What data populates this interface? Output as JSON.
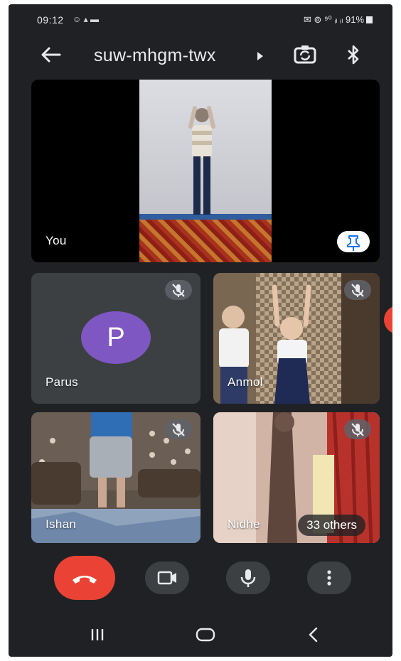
{
  "status_bar": {
    "time": "09:12",
    "left_icons": "☺ ▴ ▬",
    "right_text": "✉ ⊚ ⁹⁰ ᵢₗ ᵢₗ 91%",
    "battery_percent": "91%"
  },
  "app_bar": {
    "meeting_code": "suw-mhgm-twx",
    "icons": [
      "back-arrow-icon",
      "caret-right-icon",
      "switch-camera-icon",
      "bluetooth-icon"
    ]
  },
  "tiles": {
    "you": {
      "label": "You"
    },
    "parus": {
      "label": "Parus",
      "avatar_letter": "P",
      "avatar_color": "#7e57c2"
    },
    "anmol": {
      "label": "Anmol"
    },
    "ishan": {
      "label": "Ishan"
    },
    "nidhi": {
      "label": "Nidhe"
    },
    "others_chip": "33 others"
  },
  "controls": {
    "hangup_color": "#ea4335",
    "icons": [
      "call-end-icon",
      "camera-icon",
      "mic-icon",
      "more-vert-icon"
    ]
  },
  "nav_bar": {
    "icons": [
      "recents-icon",
      "home-icon",
      "back-icon"
    ]
  }
}
